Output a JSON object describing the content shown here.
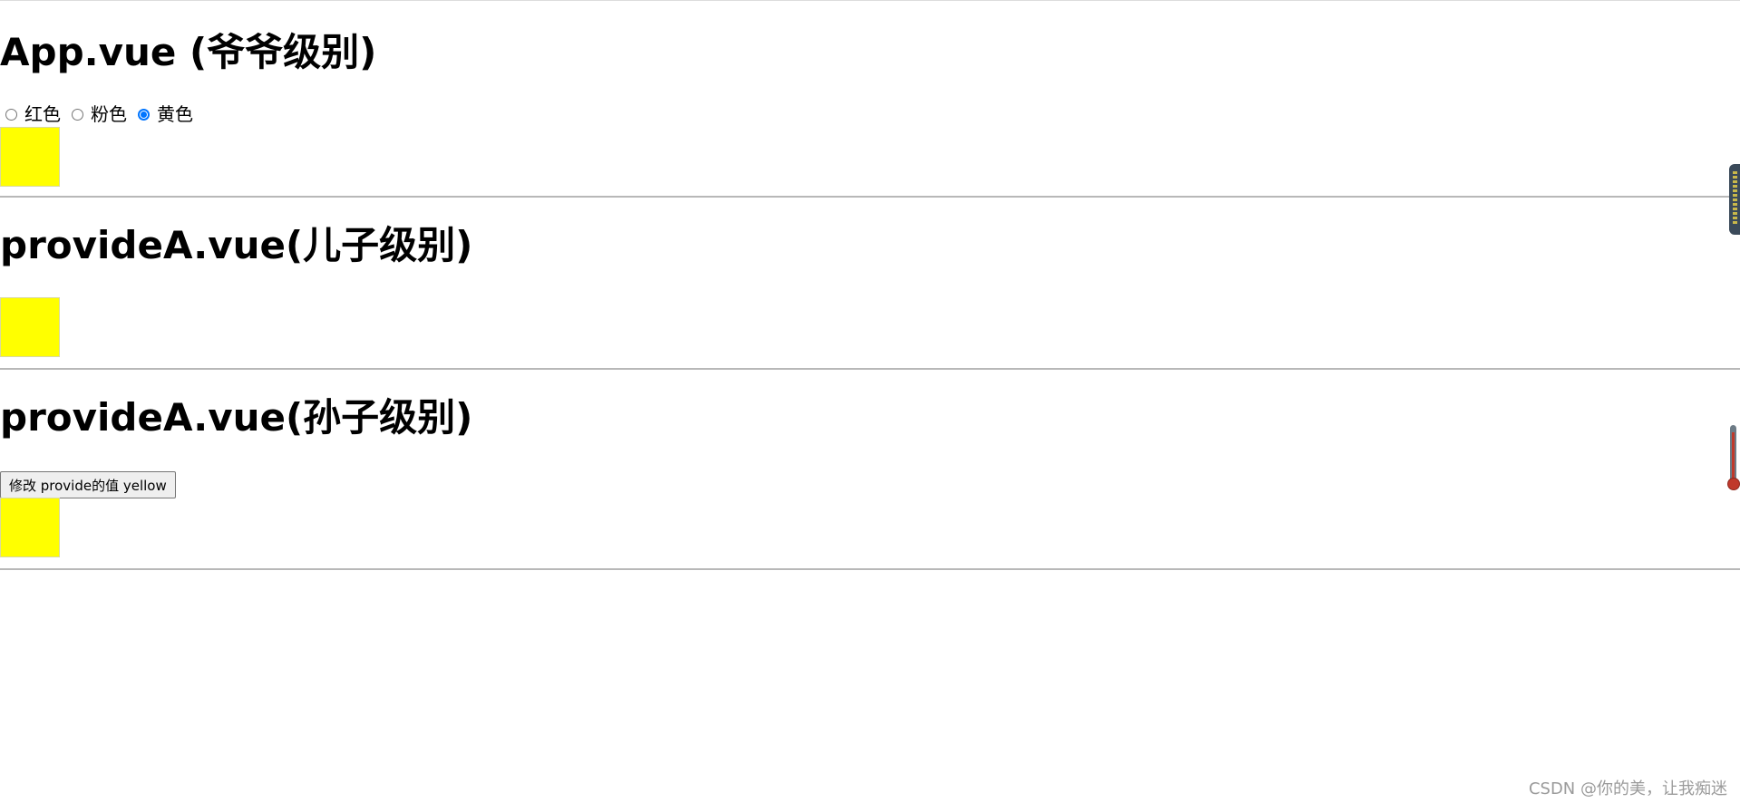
{
  "app": {
    "title": "App.vue (爷爷级别)",
    "radio_options": [
      {
        "label": "红色",
        "checked": false
      },
      {
        "label": "粉色",
        "checked": false
      },
      {
        "label": "黄色",
        "checked": true
      }
    ],
    "swatch_color": "#ffff00"
  },
  "child": {
    "title": "provideA.vue(儿子级别)",
    "swatch_color": "#ffff00"
  },
  "grandchild": {
    "title": "provideA.vue(孙子级别)",
    "button_label": "修改 provide的值 yellow",
    "swatch_color": "#ffff00"
  },
  "side_widgets": {
    "meter_icon": "level-meter-icon",
    "thermometer_icon": "thermometer-icon"
  },
  "watermark": "CSDN @你的美，让我痴迷",
  "colors": {
    "radio_accent": "#0075ff",
    "divider": "#b8b8b8",
    "watermark_text": "#9b9b9b"
  }
}
